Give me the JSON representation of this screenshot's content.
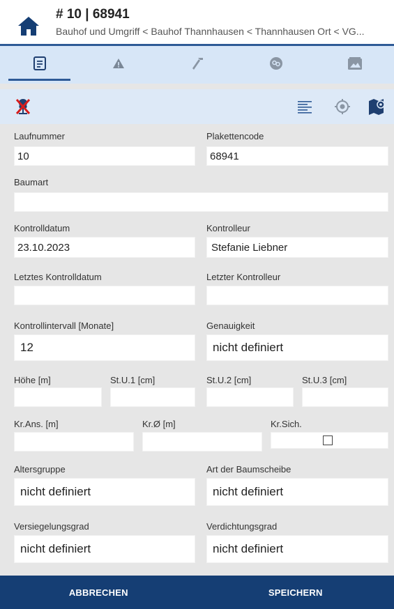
{
  "header": {
    "title": "# 10 | 68941",
    "breadcrumb": "Bauhof und Umgriff < Bauhof Thannhausen < Thannhausen Ort < VG..."
  },
  "tabs": [
    {
      "icon": "document-icon",
      "active": true
    },
    {
      "icon": "warning-icon",
      "active": false
    },
    {
      "icon": "hammer-icon",
      "active": false
    },
    {
      "icon": "fungus-icon",
      "active": false
    },
    {
      "icon": "image-icon",
      "active": false
    }
  ],
  "toolbar": {
    "left_icon": "tree-crossed-icon",
    "right_icons": [
      "align-left-icon",
      "target-icon",
      "map-marker-icon"
    ]
  },
  "colors": {
    "accent": "#2e5a96",
    "footer": "#153e74",
    "tab_bg": "#d7e6f7"
  },
  "form": {
    "laufnummer": {
      "label": "Laufnummer",
      "value": "10"
    },
    "plakettencode": {
      "label": "Plakettencode",
      "value": "68941"
    },
    "baumart": {
      "label": "Baumart",
      "value": ""
    },
    "kontrolldatum": {
      "label": "Kontrolldatum",
      "value": "23.10.2023"
    },
    "kontrolleur": {
      "label": "Kontrolleur",
      "value": "Stefanie Liebner"
    },
    "letztes_kontrolldatum": {
      "label": "Letztes Kontrolldatum",
      "value": ""
    },
    "letzter_kontrolleur": {
      "label": "Letzter Kontrolleur",
      "value": ""
    },
    "kontrollintervall": {
      "label": "Kontrollintervall [Monate]",
      "value": "12"
    },
    "genauigkeit": {
      "label": "Genauigkeit",
      "value": "nicht definiert"
    },
    "hoehe": {
      "label": "Höhe [m]",
      "value": ""
    },
    "stu1": {
      "label": "St.U.1 [cm]",
      "value": ""
    },
    "stu2": {
      "label": "St.U.2 [cm]",
      "value": ""
    },
    "stu3": {
      "label": "St.U.3 [cm]",
      "value": ""
    },
    "krans": {
      "label": "Kr.Ans. [m]",
      "value": ""
    },
    "krdurch": {
      "label": "Kr.Ø [m]",
      "value": ""
    },
    "krsich": {
      "label": "Kr.Sich.",
      "checked": false
    },
    "altersgruppe": {
      "label": "Altersgruppe",
      "value": "nicht definiert"
    },
    "baumscheibe": {
      "label": "Art der Baumscheibe",
      "value": "nicht definiert"
    },
    "versiegelungsgrad": {
      "label": "Versiegelungsgrad",
      "value": "nicht definiert"
    },
    "verdichtungsgrad": {
      "label": "Verdichtungsgrad",
      "value": "nicht definiert"
    }
  },
  "footer": {
    "cancel_label": "ABBRECHEN",
    "save_label": "SPEICHERN"
  }
}
